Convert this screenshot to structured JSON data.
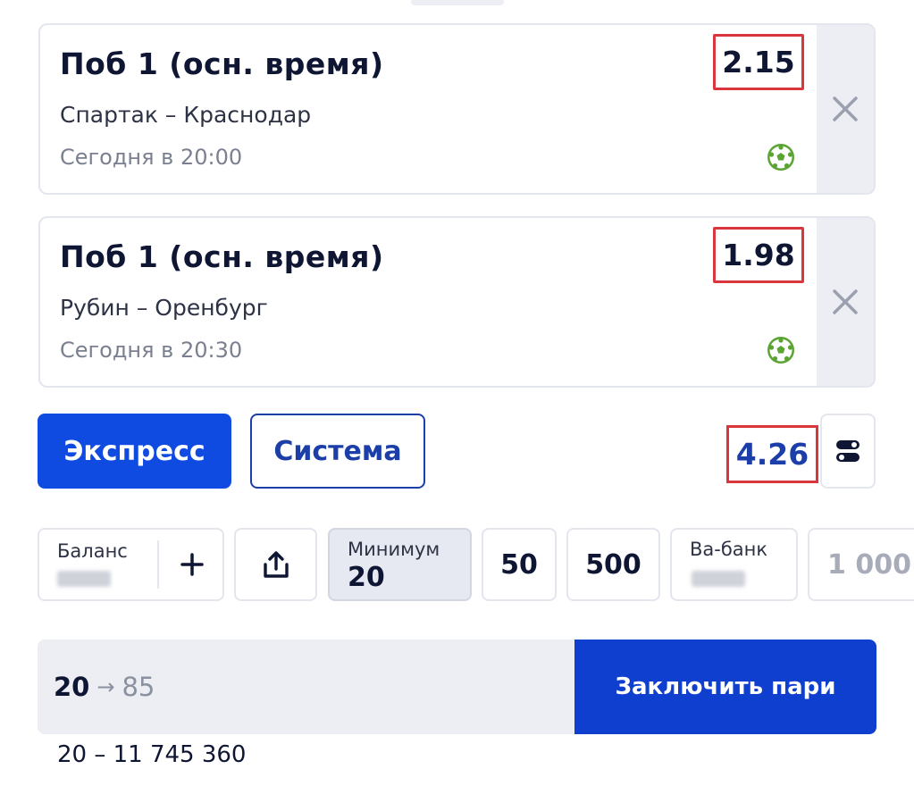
{
  "bets": [
    {
      "outcome": "Поб 1 (осн. время)",
      "odds": "2.15",
      "match": "Спартак – Краснодар",
      "time": "Сегодня в 20:00",
      "sport_icon": "football-icon"
    },
    {
      "outcome": "Поб 1 (осн. время)",
      "odds": "1.98",
      "match": "Рубин – Оренбург",
      "time": "Сегодня в 20:30",
      "sport_icon": "football-icon"
    }
  ],
  "bet_type": {
    "express_label": "Экспресс",
    "system_label": "Система",
    "selected": "Экспресс"
  },
  "total_odds": "4.26",
  "quick_stakes": {
    "balance_label": "Баланс",
    "minimum_label": "Минимум",
    "minimum_value": "20",
    "amounts": [
      "50",
      "500"
    ],
    "allin_label": "Ва-банк",
    "overflow_amount": "1 000"
  },
  "stake": {
    "amount": "20",
    "arrow": "→",
    "payout": "85"
  },
  "place_bet_label": "Заключить пари",
  "limits": "20 – 11 745 360",
  "colors": {
    "primary": "#0f4be0",
    "highlight_box": "#d9363e",
    "football_icon": "#5aa532"
  }
}
